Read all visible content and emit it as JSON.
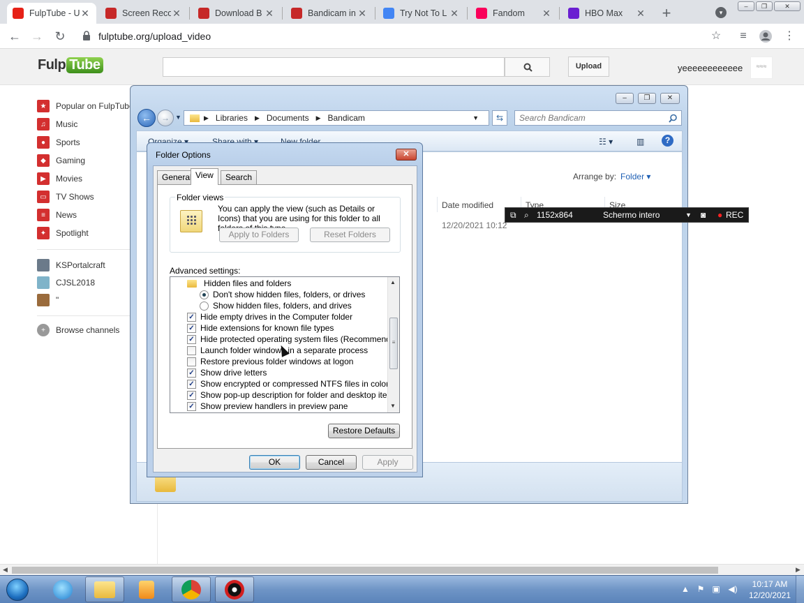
{
  "browser": {
    "tabs": [
      {
        "title": "FulpTube - U",
        "active": true,
        "icon_color": "#e62117"
      },
      {
        "title": "Screen Reco",
        "icon_color": "#c62828"
      },
      {
        "title": "Download B",
        "icon_color": "#c62828"
      },
      {
        "title": "Bandicam in",
        "icon_color": "#c62828"
      },
      {
        "title": "Try Not To L",
        "icon_color": "#4285f4"
      },
      {
        "title": "Fandom",
        "icon_color": "#fa005a"
      },
      {
        "title": "HBO Max",
        "icon_color": "#6a1fd1"
      }
    ],
    "url": "fulptube.org/upload_video"
  },
  "site": {
    "logo_text_a": "Fulp",
    "logo_text_b": "Tube",
    "search_value": "",
    "upload_label": "Upload",
    "username": "yeeeeeeeeeeee",
    "sidebar": [
      {
        "label": "Popular on FulpTube",
        "icon": "star-icon",
        "color": "#d32f2f"
      },
      {
        "label": "Music",
        "icon": "headphones-icon",
        "color": "#d32f2f"
      },
      {
        "label": "Sports",
        "icon": "sports-icon",
        "color": "#d32f2f"
      },
      {
        "label": "Gaming",
        "icon": "gamepad-icon",
        "color": "#d32f2f"
      },
      {
        "label": "Movies",
        "icon": "film-icon",
        "color": "#d32f2f"
      },
      {
        "label": "TV Shows",
        "icon": "tv-icon",
        "color": "#d32f2f"
      },
      {
        "label": "News",
        "icon": "news-icon",
        "color": "#d32f2f"
      },
      {
        "label": "Spotlight",
        "icon": "spotlight-icon",
        "color": "#d32f2f"
      }
    ],
    "subscriptions": [
      {
        "label": "KSPortalcraft",
        "color": "#6b7a8a"
      },
      {
        "label": "CJSL2018",
        "color": "#7fb3c9"
      },
      {
        "label": "\"",
        "color": "#9a6b3c"
      }
    ],
    "browse_channels": "Browse channels"
  },
  "explorer": {
    "path": [
      "Libraries",
      "Documents",
      "Bandicam"
    ],
    "search_placeholder": "Search Bandicam",
    "toolbar": {
      "organize": "Organize",
      "share_with": "Share with",
      "new_folder": "New folder"
    },
    "arrange_by_label": "Arrange by:",
    "arrange_by_value": "Folder",
    "columns": {
      "date_modified": "Date modified",
      "type": "Type",
      "size": "Size"
    },
    "file_date": "12/20/2021 10:12"
  },
  "bandicam": {
    "resolution": "1152x864",
    "mode": "Schermo intero",
    "rec": "REC"
  },
  "dialog": {
    "title": "Folder Options",
    "close": "✕",
    "tabs": [
      "General",
      "View",
      "Search"
    ],
    "active_tab": "View",
    "folder_views_legend": "Folder views",
    "folder_views_desc": "You can apply the view (such as Details or Icons) that you are using for this folder to all folders of this type.",
    "apply_to_folders": "Apply to Folders",
    "reset_folders": "Reset Folders",
    "advanced_label": "Advanced settings:",
    "advanced": [
      {
        "kind": "folder",
        "label": "Hidden files and folders"
      },
      {
        "kind": "radio",
        "checked": true,
        "label": "Don't show hidden files, folders, or drives"
      },
      {
        "kind": "radio",
        "checked": false,
        "label": "Show hidden files, folders, and drives"
      },
      {
        "kind": "check",
        "checked": true,
        "label": "Hide empty drives in the Computer folder"
      },
      {
        "kind": "check",
        "checked": true,
        "label": "Hide extensions for known file types"
      },
      {
        "kind": "check",
        "checked": true,
        "label": "Hide protected operating system files (Recommended)"
      },
      {
        "kind": "check",
        "checked": false,
        "label": "Launch folder windows in a separate process"
      },
      {
        "kind": "check",
        "checked": false,
        "label": "Restore previous folder windows at logon"
      },
      {
        "kind": "check",
        "checked": true,
        "label": "Show drive letters"
      },
      {
        "kind": "check",
        "checked": true,
        "label": "Show encrypted or compressed NTFS files in color"
      },
      {
        "kind": "check",
        "checked": true,
        "label": "Show pop-up description for folder and desktop items"
      },
      {
        "kind": "check",
        "checked": true,
        "label": "Show preview handlers in preview pane"
      }
    ],
    "restore_defaults": "Restore Defaults",
    "ok": "OK",
    "cancel": "Cancel",
    "apply": "Apply"
  },
  "taskbar": {
    "time": "10:17 AM",
    "date": "12/20/2021"
  }
}
